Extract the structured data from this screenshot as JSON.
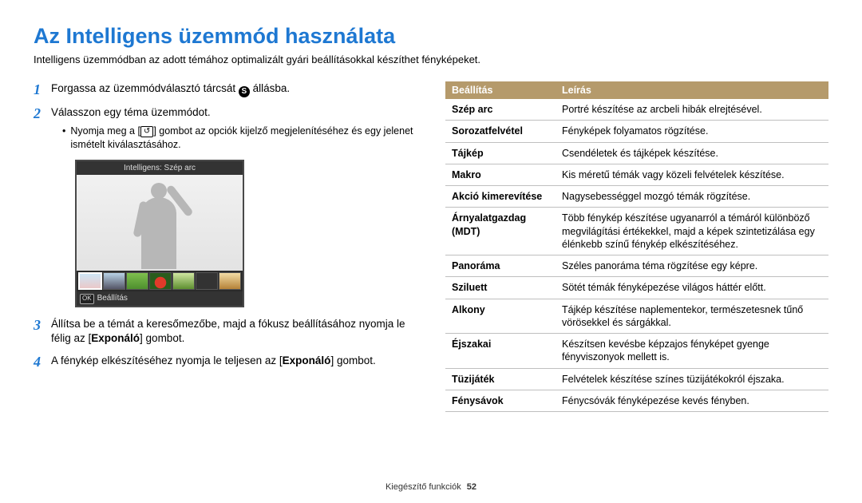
{
  "title": "Az Intelligens üzemmód használata",
  "intro": "Intelligens üzemmódban az adott témához optimalizált gyári beállításokkal készíthet fényképeket.",
  "mode_icon": "S",
  "back_icon": "↺",
  "steps": {
    "s1_a": "Forgassa az üzemmódválasztó tárcsát ",
    "s1_b": " állásba.",
    "s2": "Válasszon egy téma üzemmódot.",
    "s2_sub_a": "Nyomja meg a [",
    "s2_sub_b": "] gombot az opciók kijelző megjelenítéséhez és egy jelenet ismételt kiválasztásához.",
    "s3_a": "Állítsa be a témát a keresőmezőbe, majd a fókusz beállításához nyomja le félig az [",
    "s3_bold": "Exponáló",
    "s3_b": "] gombot.",
    "s4_a": "A fénykép elkészítéséhez nyomja le teljesen az [",
    "s4_bold": "Exponáló",
    "s4_b": "] gombot."
  },
  "camera": {
    "title": "Intelligens: Szép arc",
    "ok": "OK",
    "ok_label": "Beállítás"
  },
  "table": {
    "headers": {
      "setting": "Beállítás",
      "desc": "Leírás"
    },
    "rows": [
      {
        "name": "Szép arc",
        "desc": "Portré készítése az arcbeli hibák elrejtésével."
      },
      {
        "name": "Sorozatfelvétel",
        "desc": "Fényképek folyamatos rögzítése."
      },
      {
        "name": "Tájkép",
        "desc": "Csendéletek és tájképek készítése."
      },
      {
        "name": "Makro",
        "desc": "Kis méretű témák vagy közeli felvételek készítése."
      },
      {
        "name": "Akció kimerevítése",
        "desc": "Nagysebességgel mozgó témák rögzítése."
      },
      {
        "name": "Árnyalatgazdag (MDT)",
        "desc": "Több fénykép készítése ugyanarról a témáról különböző megvilágítási értékekkel, majd a képek szintetizálása egy élénkebb színű fénykép elkészítéséhez."
      },
      {
        "name": "Panoráma",
        "desc": "Széles panoráma téma rögzítése egy képre."
      },
      {
        "name": "Sziluett",
        "desc": "Sötét témák fényképezése világos háttér előtt."
      },
      {
        "name": "Alkony",
        "desc": "Tájkép készítése naplementekor, természetesnek tűnő vörösekkel és sárgákkal."
      },
      {
        "name": "Éjszakai",
        "desc": "Készítsen kevésbe képzajos fényképet gyenge fényviszonyok mellett is."
      },
      {
        "name": "Tüzijáték",
        "desc": "Felvételek készítése színes tüzijátékokról éjszaka."
      },
      {
        "name": "Fénysávok",
        "desc": "Fénycsóvák fényképezése kevés fényben."
      }
    ]
  },
  "footer": {
    "section": "Kiegészítő funkciók",
    "page": "52"
  }
}
